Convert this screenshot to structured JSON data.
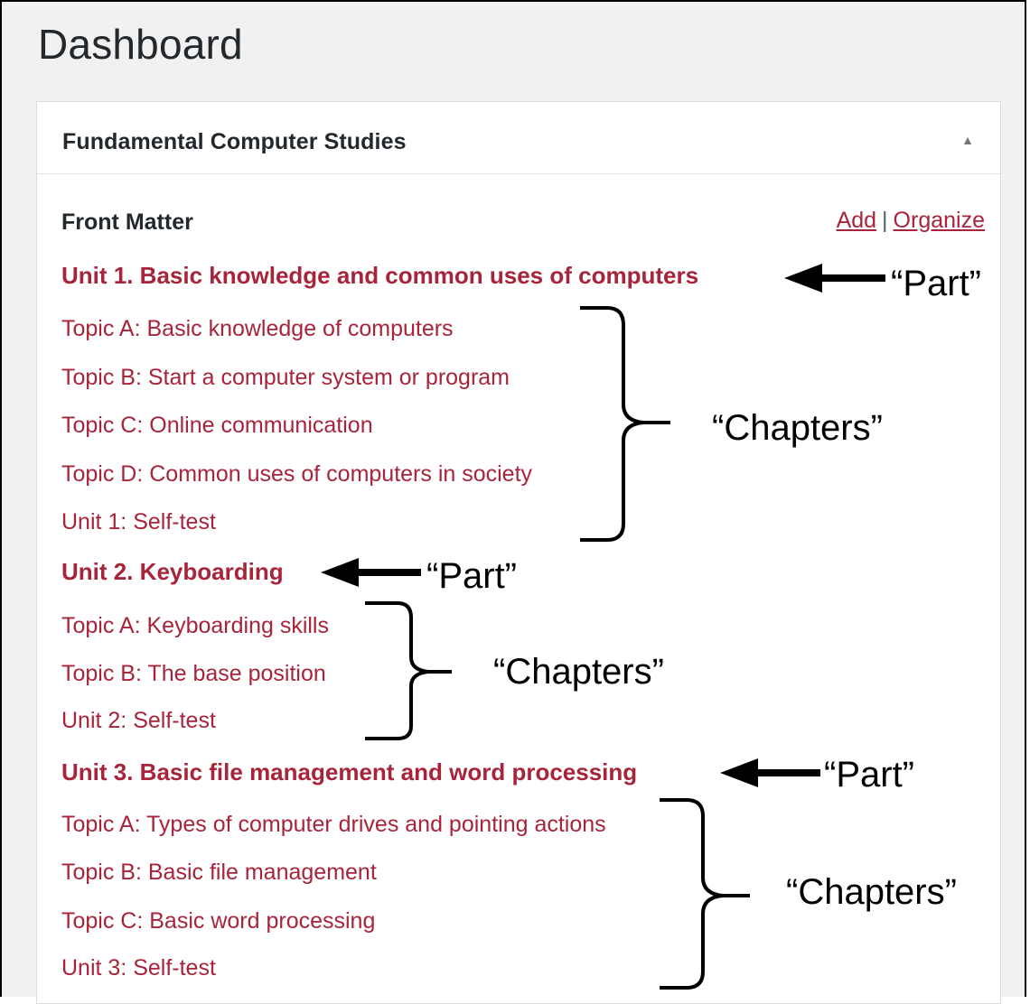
{
  "page": {
    "title": "Dashboard"
  },
  "panel": {
    "title": "Fundamental Computer Studies",
    "toggle_glyph": "▲",
    "front_matter": "Front Matter",
    "actions": {
      "add": "Add",
      "separator": "|",
      "organize": "Organize"
    }
  },
  "units": [
    {
      "part": "Unit 1. Basic knowledge and common uses of computers",
      "chapters": [
        "Topic A: Basic knowledge of computers",
        "Topic B: Start a computer system or program",
        "Topic C: Online communication",
        "Topic D: Common uses of computers in society",
        "Unit 1: Self-test"
      ]
    },
    {
      "part": "Unit 2. Keyboarding",
      "chapters": [
        "Topic A: Keyboarding skills",
        "Topic B: The base position",
        "Unit 2: Self-test"
      ]
    },
    {
      "part": "Unit 3. Basic file management and word processing",
      "chapters": [
        "Topic A: Types of computer drives and pointing actions",
        "Topic B: Basic file management",
        "Topic C: Basic word processing",
        "Unit 3: Self-test"
      ]
    }
  ],
  "annotations": {
    "part_label": "“Part”",
    "chapters_label": "“Chapters”"
  }
}
